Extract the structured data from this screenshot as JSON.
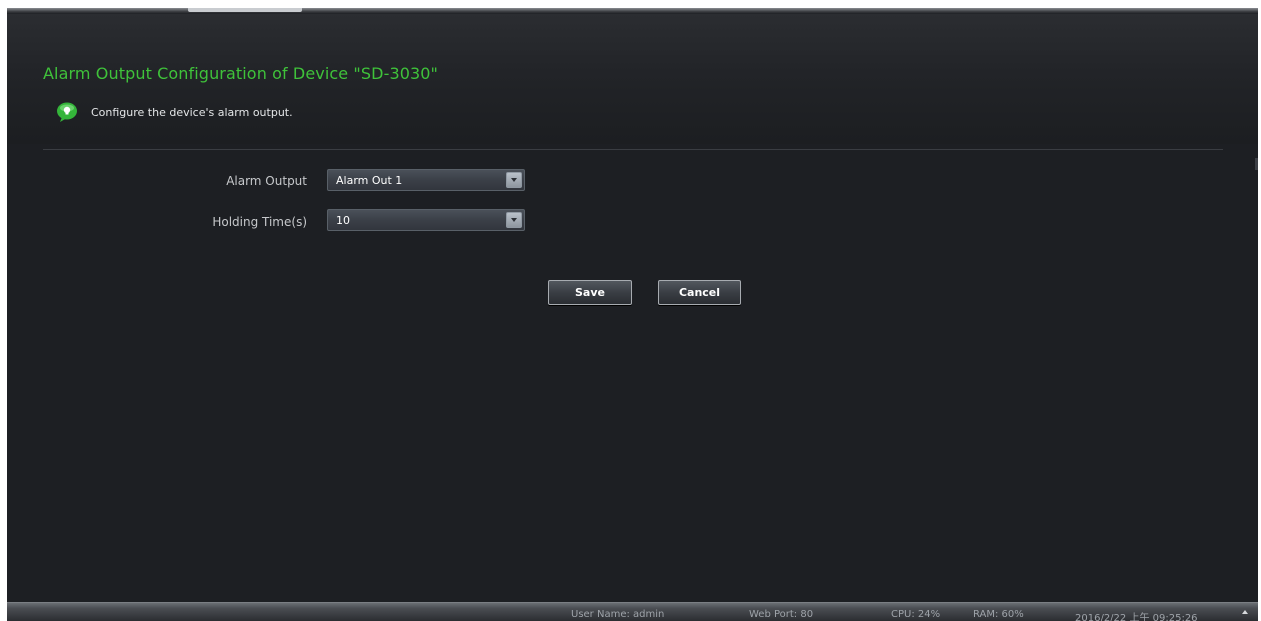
{
  "header": {
    "title": "Alarm Output Configuration of Device \"SD-3030\"",
    "subtitle": "Configure the device's alarm output.",
    "tip_icon": "lightbulb-icon"
  },
  "form": {
    "alarm_output": {
      "label": "Alarm Output",
      "value": "Alarm Out 1"
    },
    "holding_time": {
      "label": "Holding Time(s)",
      "value": "10"
    }
  },
  "buttons": {
    "save": "Save",
    "cancel": "Cancel"
  },
  "statusbar": {
    "user": "User Name: admin",
    "web_port": "Web Port: 80",
    "cpu": "CPU: 24%",
    "ram": "RAM: 60%",
    "datetime": "2016/2/22 上午 09:25:26"
  },
  "colors": {
    "title_green": "#3fc23a",
    "background": "#1d1f23"
  }
}
